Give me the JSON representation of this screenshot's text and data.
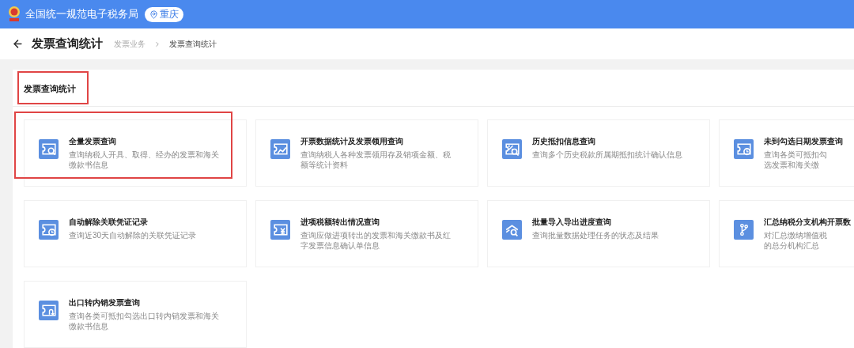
{
  "header": {
    "title": "全国统一规范电子税务局",
    "location": "重庆"
  },
  "page": {
    "title": "发票查询统计",
    "breadcrumb": [
      "发票业务",
      "发票查询统计"
    ]
  },
  "section": {
    "title": "发票查询统计",
    "highlighted": true
  },
  "cards": [
    {
      "kind": "search",
      "title": "全量发票查询",
      "description": "查询纳税人开具、取得、经办的发票和海关缴款书信息",
      "highlighted": true
    },
    {
      "kind": "chart",
      "title": "开票数据统计及发票领用查询",
      "description": "查询纳税人各种发票领用存及销项金额、税额等统计资料",
      "highlighted": false
    },
    {
      "kind": "percent",
      "title": "历史抵扣信息查询",
      "description": "查询多个历史税款所属期抵扣统计确认信息",
      "highlighted": false
    },
    {
      "kind": "clock",
      "title": "未到勾选日期发票查询",
      "description": "查询各类可抵扣勾选发票和海关缴",
      "highlighted": false
    },
    {
      "kind": "clock",
      "title": "自动解除关联凭证记录",
      "description": "查询近30天自动解除的关联凭证记录",
      "highlighted": false
    },
    {
      "kind": "yen",
      "title": "进项税额转出情况查询",
      "description": "查询应做进项转出的发票和海关缴款书及红字发票信息确认单信息",
      "highlighted": false
    },
    {
      "kind": "layers",
      "title": "批量导入导出进度查询",
      "description": "查询批量数据处理任务的状态及结果",
      "highlighted": false
    },
    {
      "kind": "branch",
      "title": "汇总纳税分支机构开票数",
      "description": "对汇总缴纳增值税的总分机构汇总",
      "highlighted": false
    },
    {
      "kind": "return",
      "title": "出口转内销发票查询",
      "description": "查询各类可抵扣勾选出口转内销发票和海关缴款书信息",
      "highlighted": false
    }
  ]
}
